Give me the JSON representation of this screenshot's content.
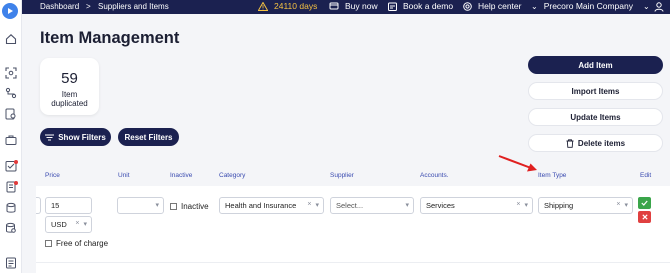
{
  "topbar": {
    "crumb_1": "Dashboard",
    "separator": ">",
    "crumb_2": "Suppliers and Items",
    "days_remaining": "24110 days",
    "buy_now": "Buy now",
    "book_demo": "Book a demo",
    "help_center": "Help center",
    "company": "Precoro Main Company",
    "warn_color": "#f5c242"
  },
  "sidebar": {
    "icons": [
      "logo-icon",
      "home-icon",
      "scan-icon",
      "route-icon",
      "search-doc-icon",
      "briefcase-icon",
      "checklist-icon",
      "document-icon",
      "database-icon",
      "database-search-icon",
      "report-icon"
    ]
  },
  "page": {
    "title": "Item Management",
    "stat_value": "59",
    "stat_label_1": "Item",
    "stat_label_2": "duplicated"
  },
  "filters": {
    "show_filters": "Show Filters",
    "reset_filters": "Reset Filters"
  },
  "actions": {
    "add_item": "Add Item",
    "import_items": "Import Items",
    "update_items": "Update Items",
    "delete_items": "Delete items"
  },
  "table": {
    "headers": {
      "price": "Price",
      "unit": "Unit",
      "inactive": "Inactive",
      "category": "Category",
      "supplier": "Supplier",
      "accounts": "Accounts.",
      "item_type": "Item Type",
      "edit": "Edit"
    },
    "row": {
      "price": "15",
      "currency": "USD",
      "unit": "",
      "inactive_label": "Inactive",
      "free_of_charge": "Free of charge",
      "category": "Health and Insurance",
      "supplier_placeholder": "Select...",
      "account": "Services",
      "item_type": "Shipping",
      "clear_symbol": "×",
      "dropdown_symbol": "▾"
    }
  },
  "colors": {
    "navy": "#1b2150",
    "accent_blue": "#3a4bb0",
    "arrow_red": "#e02020",
    "confirm_green": "#3aa54a",
    "delete_red": "#e04040"
  }
}
